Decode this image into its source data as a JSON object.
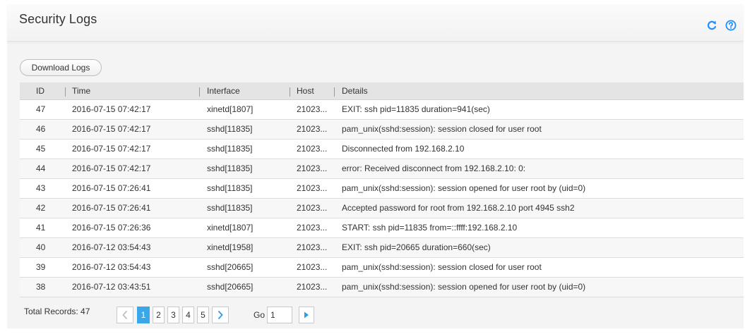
{
  "header": {
    "title": "Security Logs",
    "refresh_icon": "refresh-icon",
    "help_icon": "help-icon",
    "accent_color": "#1e90ff"
  },
  "toolbar": {
    "download_label": "Download Logs"
  },
  "table": {
    "columns": [
      "ID",
      "Time",
      "Interface",
      "Host",
      "Details"
    ],
    "rows": [
      {
        "id": "47",
        "time": "2016-07-15 07:42:17",
        "interface": "xinetd[1807]",
        "host": "21023...",
        "details": "EXIT: ssh pid=11835 duration=941(sec)"
      },
      {
        "id": "46",
        "time": "2016-07-15 07:42:17",
        "interface": "sshd[11835]",
        "host": "21023...",
        "details": "pam_unix(sshd:session): session closed for user root"
      },
      {
        "id": "45",
        "time": "2016-07-15 07:42:17",
        "interface": "sshd[11835]",
        "host": "21023...",
        "details": "Disconnected from 192.168.2.10"
      },
      {
        "id": "44",
        "time": "2016-07-15 07:42:17",
        "interface": "sshd[11835]",
        "host": "21023...",
        "details": "error: Received disconnect from 192.168.2.10: 0:"
      },
      {
        "id": "43",
        "time": "2016-07-15 07:26:41",
        "interface": "sshd[11835]",
        "host": "21023...",
        "details": "pam_unix(sshd:session): session opened for user root by (uid=0)"
      },
      {
        "id": "42",
        "time": "2016-07-15 07:26:41",
        "interface": "sshd[11835]",
        "host": "21023...",
        "details": "Accepted password for root from 192.168.2.10 port 4945 ssh2"
      },
      {
        "id": "41",
        "time": "2016-07-15 07:26:36",
        "interface": "xinetd[1807]",
        "host": "21023...",
        "details": "START: ssh pid=11835 from=::ffff:192.168.2.10"
      },
      {
        "id": "40",
        "time": "2016-07-12 03:54:43",
        "interface": "xinetd[1958]",
        "host": "21023...",
        "details": "EXIT: ssh pid=20665 duration=660(sec)"
      },
      {
        "id": "39",
        "time": "2016-07-12 03:54:43",
        "interface": "sshd[20665]",
        "host": "21023...",
        "details": "pam_unix(sshd:session): session closed for user root"
      },
      {
        "id": "38",
        "time": "2016-07-12 03:43:51",
        "interface": "sshd[20665]",
        "host": "21023...",
        "details": "pam_unix(sshd:session): session opened for user root by (uid=0)"
      }
    ]
  },
  "pagination": {
    "total_label": "Total Records: 47",
    "prev_icon": "chevron-left-icon",
    "next_icon": "chevron-right-icon",
    "pages": [
      "1",
      "2",
      "3",
      "4",
      "5"
    ],
    "current_page": "1",
    "go_label": "Go",
    "go_value": "1",
    "go_icon": "play-arrow-icon"
  }
}
